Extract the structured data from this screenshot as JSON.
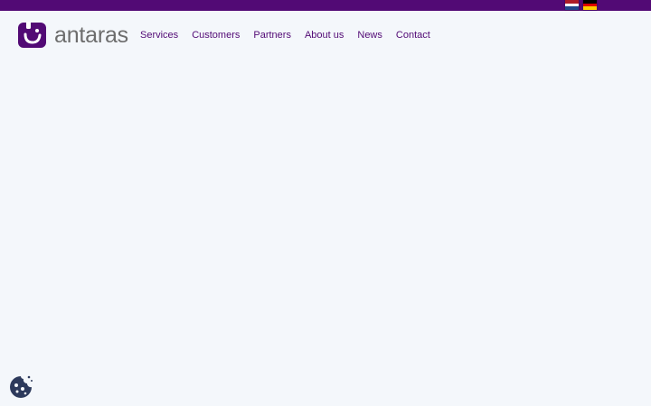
{
  "brand": {
    "name": "antaras",
    "accent": "#520a75",
    "logo_mark": "smile-square-icon"
  },
  "languages": [
    {
      "code": "nl",
      "icon": "flag-nl-icon",
      "colors": [
        "#ae1c28",
        "#ffffff",
        "#21468b"
      ]
    },
    {
      "code": "de",
      "icon": "flag-de-icon",
      "colors": [
        "#000000",
        "#dd0000",
        "#ffce00"
      ]
    }
  ],
  "nav": {
    "items": [
      {
        "label": "Services"
      },
      {
        "label": "Customers"
      },
      {
        "label": "Partners"
      },
      {
        "label": "About us"
      },
      {
        "label": "News"
      },
      {
        "label": "Contact"
      }
    ]
  },
  "cookie_button": {
    "icon": "cookie-icon",
    "color": "#2d3a5c"
  }
}
